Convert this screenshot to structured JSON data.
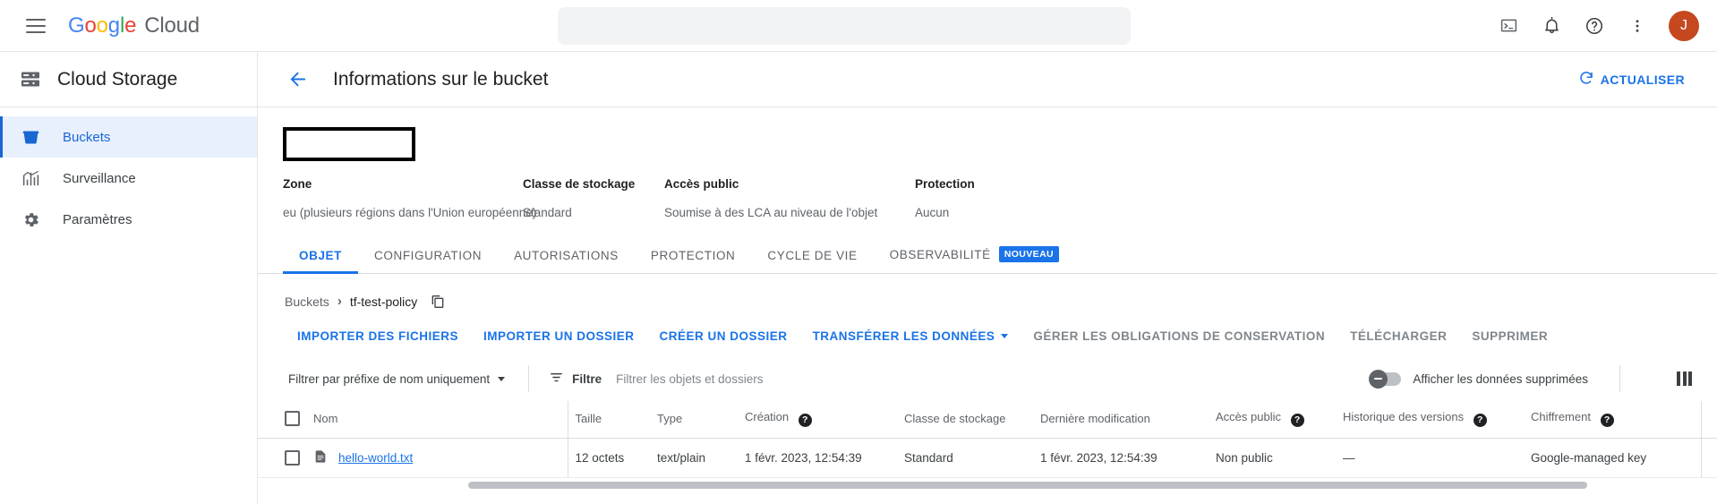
{
  "topbar": {
    "menu_icon": "hamburger-menu-icon",
    "brand": {
      "g1": "G",
      "o1": "o",
      "o2": "o",
      "g2": "g",
      "l1": "l",
      "e1": "e",
      "cloud": "Cloud"
    },
    "search": {
      "value": "",
      "placeholder": ""
    },
    "icons": [
      "terminal-icon",
      "notifications-bell-icon",
      "help-icon",
      "more-options-icon"
    ],
    "avatar_initial": "J",
    "avatar_color": "#c5481f"
  },
  "sidebar": {
    "product_icon": "cloud-storage-icon",
    "product_name": "Cloud Storage",
    "items": [
      {
        "label": "Buckets",
        "icon": "bucket-icon",
        "active": true
      },
      {
        "label": "Surveillance",
        "icon": "monitoring-chart-icon",
        "active": false
      },
      {
        "label": "Paramètres",
        "icon": "settings-gear-icon",
        "active": false
      }
    ]
  },
  "page": {
    "back_icon": "arrow-left-icon",
    "title": "Informations sur le bucket",
    "refresh_label": "ACTUALISER",
    "refresh_icon": "refresh-icon"
  },
  "summary": {
    "redacted_bucket_name": "",
    "fields": [
      {
        "label": "Zone",
        "value": "eu (plusieurs régions dans l'Union européenne)"
      },
      {
        "label": "Classe de stockage",
        "value": "Standard"
      },
      {
        "label": "Accès public",
        "value": "Soumise à des LCA au niveau de l'objet"
      },
      {
        "label": "Protection",
        "value": "Aucun"
      }
    ]
  },
  "tabs": [
    {
      "label": "OBJET",
      "active": true,
      "badge": ""
    },
    {
      "label": "CONFIGURATION",
      "active": false,
      "badge": ""
    },
    {
      "label": "AUTORISATIONS",
      "active": false,
      "badge": ""
    },
    {
      "label": "PROTECTION",
      "active": false,
      "badge": ""
    },
    {
      "label": "CYCLE DE VIE",
      "active": false,
      "badge": ""
    },
    {
      "label": "OBSERVABILITÉ",
      "active": false,
      "badge": "NOUVEAU"
    }
  ],
  "breadcrumb": {
    "root": "Buckets",
    "separator": "›",
    "current": "tf-test-policy",
    "copy_icon": "copy-icon"
  },
  "actions": [
    {
      "label": "IMPORTER DES FICHIERS",
      "disabled": false,
      "caret": false
    },
    {
      "label": "IMPORTER UN DOSSIER",
      "disabled": false,
      "caret": false
    },
    {
      "label": "CRÉER UN DOSSIER",
      "disabled": false,
      "caret": false
    },
    {
      "label": "TRANSFÉRER LES DONNÉES",
      "disabled": false,
      "caret": true
    },
    {
      "label": "GÉRER LES OBLIGATIONS DE CONSERVATION",
      "disabled": true,
      "caret": false
    },
    {
      "label": "TÉLÉCHARGER",
      "disabled": true,
      "caret": false
    },
    {
      "label": "SUPPRIMER",
      "disabled": true,
      "caret": false
    }
  ],
  "filterbar": {
    "prefix_select": "Filtrer par préfixe de nom uniquement",
    "filter_icon": "filter-icon",
    "filter_label": "Filtre",
    "filter_placeholder": "Filtrer les objets et dossiers",
    "toggle_label": "Afficher les données supprimées",
    "toggle_on": false,
    "columns_icon": "column-settings-icon"
  },
  "table": {
    "columns": [
      {
        "label": "Nom",
        "help": false
      },
      {
        "label": "Taille",
        "help": false
      },
      {
        "label": "Type",
        "help": false
      },
      {
        "label": "Création",
        "help": true
      },
      {
        "label": "Classe de stockage",
        "help": false
      },
      {
        "label": "Dernière modification",
        "help": false
      },
      {
        "label": "Accès public",
        "help": true
      },
      {
        "label": "Historique des versions",
        "help": true
      },
      {
        "label": "Chiffrement",
        "help": true
      }
    ],
    "help_glyph": "?",
    "rows": [
      {
        "name": "hello-world.txt",
        "file_icon": "text-file-icon",
        "size": "12 octets",
        "type": "text/plain",
        "created": "1 févr. 2023, 12:54:39",
        "storage_class": "Standard",
        "last_modified": "1 févr. 2023, 12:54:39",
        "public_access": "Non public",
        "version_history": "—",
        "encryption": "Google-managed key",
        "download_icon": "download-icon",
        "more_icon": "row-more-options-icon"
      }
    ]
  }
}
